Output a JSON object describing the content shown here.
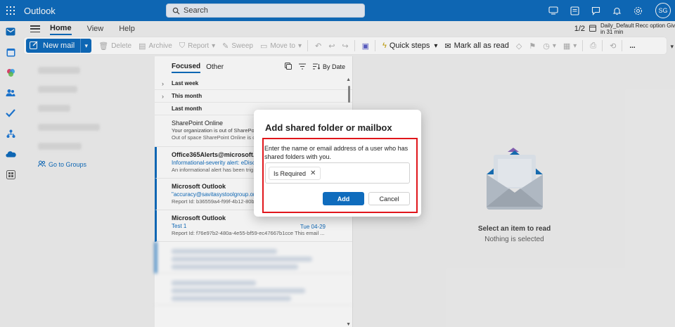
{
  "app": {
    "name": "Outlook",
    "user_initials": "SG"
  },
  "search": {
    "placeholder": "Search"
  },
  "ribbon_tabs": [
    "Home",
    "View",
    "Help"
  ],
  "reminder": {
    "count": "1/2",
    "title": "Daily_Default Recc option Give...",
    "time": "in 31 min"
  },
  "toolbar": {
    "new_mail": "New mail",
    "delete": "Delete",
    "archive": "Archive",
    "report": "Report",
    "sweep": "Sweep",
    "move_to": "Move to",
    "quick_steps": "Quick steps",
    "mark_all_read": "Mark all as read",
    "more": "..."
  },
  "folders": {
    "groups_link": "Go to Groups"
  },
  "message_list": {
    "tabs": [
      "Focused",
      "Other"
    ],
    "sort_label": "By Date",
    "groups": [
      "Last week",
      "This month",
      "Last month"
    ],
    "messages": [
      {
        "from": "SharePoint Online",
        "subject": "Your organization is out of SharePo",
        "preview": "Out of space SharePoint Online is o",
        "date": ""
      },
      {
        "from": "Office365Alerts@microsoft.co",
        "subject": "Informational-severity alert: eDisc",
        "preview": "An informational alert has been trig",
        "date": ""
      },
      {
        "from": "Microsoft Outlook",
        "subject": "\"accuracy@savitasystoolgroup.onr",
        "preview": "Report Id: b36559a4-f99f-4b12-80b",
        "date": ""
      },
      {
        "from": "Microsoft Outlook",
        "subject": "Test 1",
        "preview": "Report Id: f76e97b2-480a-4e55-bf59-ec47667b1cce This email ...",
        "date": "Tue 04-29"
      }
    ]
  },
  "reading_pane": {
    "title": "Select an item to read",
    "subtitle": "Nothing is selected"
  },
  "dialog": {
    "title": "Add shared folder or mailbox",
    "description": "Enter the name or email address of a user who has shared folders with you.",
    "chip": "Is Required",
    "add": "Add",
    "cancel": "Cancel"
  },
  "colors": {
    "brand": "#0f6cbd",
    "highlight": "#e0161b"
  }
}
